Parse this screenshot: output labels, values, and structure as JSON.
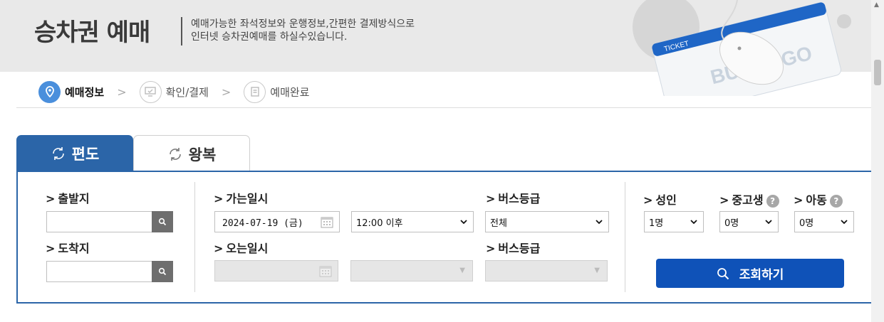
{
  "header": {
    "title": "승차권 예매",
    "desc_line1": "예매가능한 좌석정보와 운행정보,간편한 결제방식으로",
    "desc_line2": "인터넷 승차권예매를 하실수있습니다."
  },
  "illustration": {
    "ticket_label": "TICKET",
    "brand": "BUS TAGO"
  },
  "steps": [
    {
      "label": "예매정보",
      "icon": "location-pin-icon",
      "active": true
    },
    {
      "label": "확인/결제",
      "icon": "monitor-check-icon",
      "active": false
    },
    {
      "label": "예매완료",
      "icon": "document-icon",
      "active": false
    }
  ],
  "step_separator": ">",
  "tabs": {
    "oneway": "편도",
    "roundtrip": "왕복"
  },
  "form": {
    "departure_label": "출발지",
    "arrival_label": "도착지",
    "departure_value": "",
    "arrival_value": "",
    "go_datetime_label": "가는일시",
    "go_date": "2024-07-19 (금)",
    "go_time": "12:00 이후",
    "bus_grade_label": "버스등급",
    "bus_grade_value": "전체",
    "return_datetime_label": "오는일시",
    "return_date": "",
    "return_time": "",
    "return_grade_label": "버스등급",
    "return_grade_value": "",
    "adult_label": "성인",
    "youth_label": "중고생",
    "child_label": "아동",
    "adult_value": "1명",
    "youth_value": "0명",
    "child_value": "0명",
    "help_mark": "?",
    "arrow": ">",
    "search_button": "조회하기"
  },
  "colors": {
    "primary": "#2b65a8",
    "button": "#0f52b8",
    "step_active": "#4a8fdc",
    "banner_bg": "#e9e9e9"
  }
}
